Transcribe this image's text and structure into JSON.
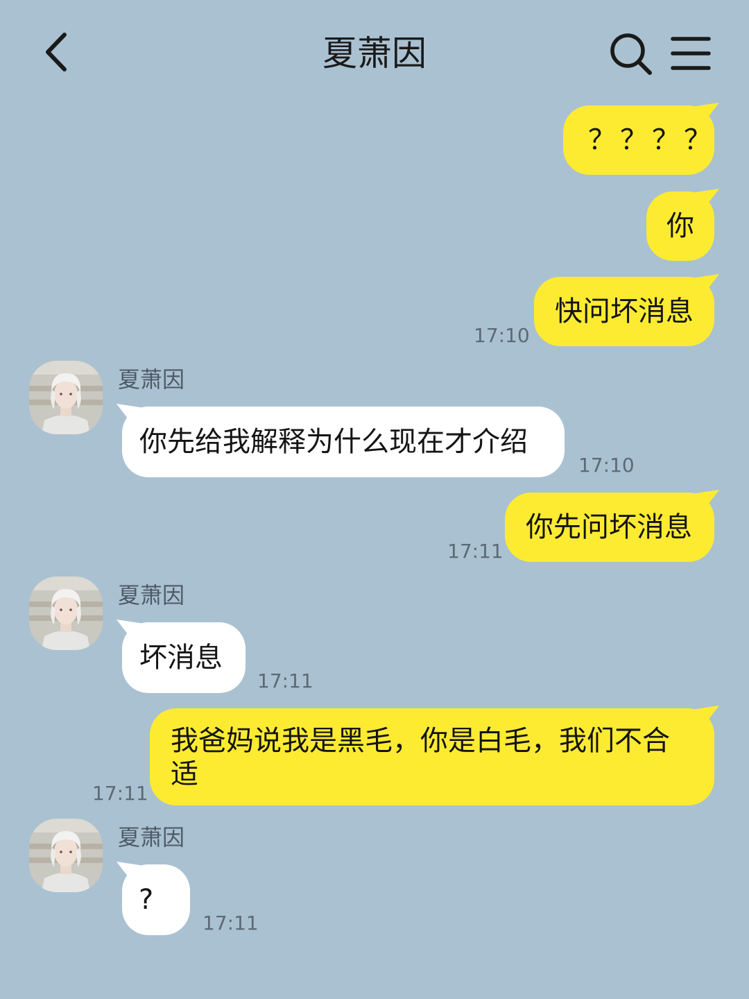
{
  "header": {
    "title": "夏萧因",
    "back_icon": "chevron-left-icon",
    "search_icon": "search-icon",
    "menu_icon": "hamburger-menu-icon"
  },
  "colors": {
    "background": "#aac1d1",
    "my_bubble": "#fdeb32",
    "their_bubble": "#ffffff",
    "timestamp": "#5c6a76"
  },
  "messages": [
    {
      "from": "me",
      "text": "？？？？"
    },
    {
      "from": "me",
      "text": "你"
    },
    {
      "from": "me",
      "text": "快问坏消息",
      "time": "17:10"
    },
    {
      "from": "them",
      "sender": "夏萧因",
      "text": "你先给我解释为什么现在才介绍",
      "time": "17:10"
    },
    {
      "from": "me",
      "text": "你先问坏消息",
      "time": "17:11"
    },
    {
      "from": "them",
      "sender": "夏萧因",
      "text": "坏消息",
      "time": "17:11"
    },
    {
      "from": "me",
      "text_line1": "我爸妈说我是黑毛，你是白毛，我们不合",
      "text_line2": "适",
      "time": "17:11"
    },
    {
      "from": "them",
      "sender": "夏萧因",
      "text": "?",
      "time": "17:11"
    }
  ]
}
